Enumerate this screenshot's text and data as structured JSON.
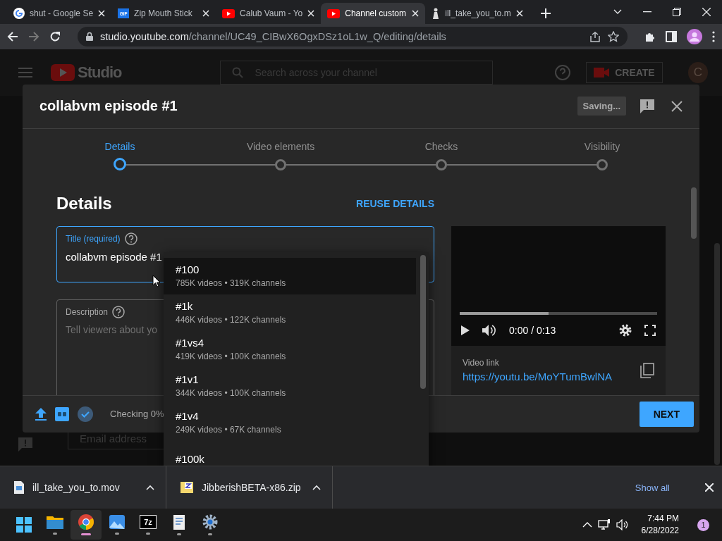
{
  "browser": {
    "tabs": [
      {
        "title": "shut - Google Se",
        "kind": "google",
        "selected": false
      },
      {
        "title": "Zip Mouth Stick",
        "kind": "gif",
        "favicon_text": "GIF",
        "selected": false
      },
      {
        "title": "Calub Vaum - Yo",
        "kind": "youtube",
        "selected": false
      },
      {
        "title": "Channel custom",
        "kind": "youtube",
        "selected": true
      },
      {
        "title": "ill_take_you_to.m",
        "kind": "figure",
        "selected": false
      }
    ],
    "url": "**studio.youtube.com**/channel/UC49_CIBwX6OgxDSz1oL1w_Q/editing/details"
  },
  "studio": {
    "logo_text": "Studio",
    "search_placeholder": "Search across your channel",
    "create_label": "CREATE",
    "avatar_letter": "C",
    "email_placeholder": "Email address"
  },
  "dialog": {
    "title": "collabvm episode #1",
    "saving_label": "Saving...",
    "steps": [
      {
        "label": "Details",
        "selected": true
      },
      {
        "label": "Video elements",
        "selected": false
      },
      {
        "label": "Checks",
        "selected": false
      },
      {
        "label": "Visibility",
        "selected": false
      }
    ],
    "section_title": "Details",
    "reuse_label": "REUSE DETAILS",
    "title_field": {
      "label": "Title (required)",
      "value": "collabvm episode #1"
    },
    "description_field": {
      "label": "Description",
      "placeholder": "Tell viewers about yo"
    },
    "video": {
      "level": 0.45,
      "time": "0:00 / 0:13",
      "link_label": "Video link",
      "link": "https://youtu.be/MoYTumBwlNA"
    },
    "status": "Checking 0%",
    "next_label": "NEXT"
  },
  "suggestions": [
    {
      "tag": "#100",
      "stats": "785K videos • 319K channels",
      "selected": true
    },
    {
      "tag": "#1k",
      "stats": "446K videos • 122K channels",
      "selected": false
    },
    {
      "tag": "#1vs4",
      "stats": "419K videos • 100K channels",
      "selected": false
    },
    {
      "tag": "#1v1",
      "stats": "344K videos • 100K channels",
      "selected": false
    },
    {
      "tag": "#1v4",
      "stats": "249K videos • 67K channels",
      "selected": false
    },
    {
      "tag": "#100k",
      "selected": false
    }
  ],
  "downloads": {
    "items": [
      {
        "name": "ill_take_you_to.mov",
        "kind": "video"
      },
      {
        "name": "JibberishBETA-x86.zip",
        "kind": "zip"
      }
    ],
    "show_all": "Show all"
  },
  "taskbar": {
    "apps": [
      {
        "kind": "start",
        "running": false,
        "selected": false
      },
      {
        "kind": "folder",
        "running": true,
        "selected": false
      },
      {
        "kind": "chrome",
        "running": true,
        "selected": true
      },
      {
        "kind": "photos",
        "running": true,
        "selected": false
      },
      {
        "kind": "sevenzip",
        "label": "7z",
        "running": true,
        "selected": false
      },
      {
        "kind": "notepad",
        "running": true,
        "selected": false
      },
      {
        "kind": "settings",
        "running": true,
        "selected": false
      }
    ],
    "time": "7:44 PM",
    "date": "6/28/2022",
    "notifications": "1"
  }
}
